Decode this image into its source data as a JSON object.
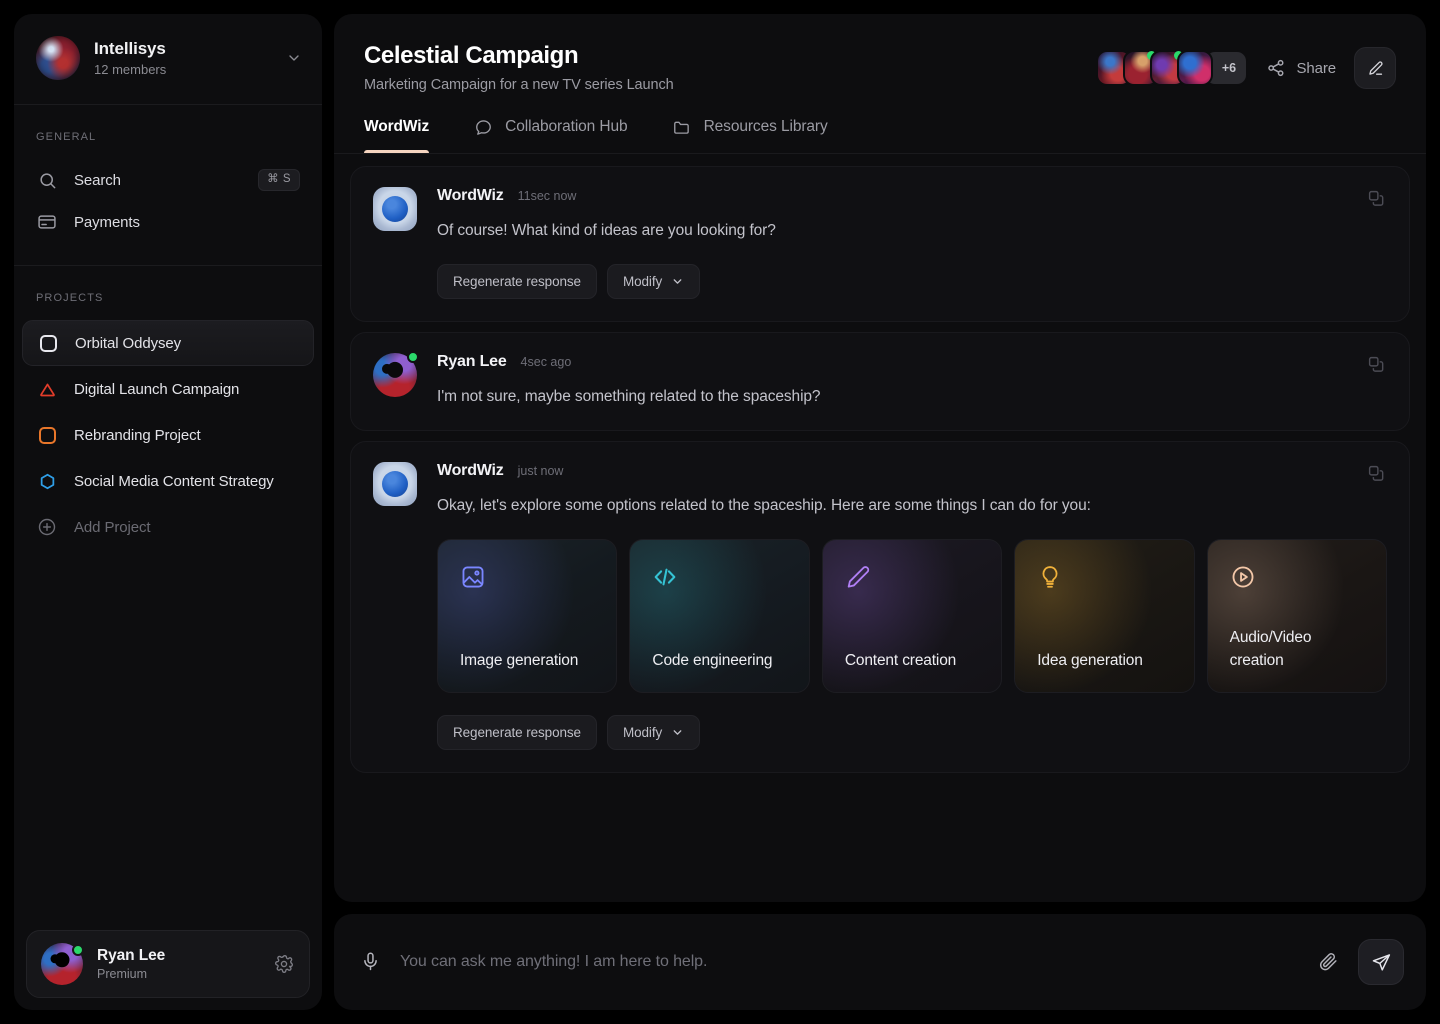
{
  "sidebar": {
    "workspace": {
      "name": "Intellisys",
      "members": "12 members",
      "chevron_icon": "chevron-down-icon"
    },
    "general_label": "GENERAL",
    "general_items": [
      {
        "label": "Search",
        "icon": "search-icon",
        "shortcut": "⌘ S"
      },
      {
        "label": "Payments",
        "icon": "credit-card-icon",
        "shortcut": ""
      }
    ],
    "projects_label": "PROJECTS",
    "projects": [
      {
        "label": "Orbital Oddysey",
        "icon": "square-icon",
        "color": "#e8e8ee",
        "active": true
      },
      {
        "label": "Digital Launch Campaign",
        "icon": "triangle-icon",
        "color": "#e23c2a",
        "active": false
      },
      {
        "label": "Rebranding Project",
        "icon": "square-icon",
        "color": "#e8762a",
        "active": false
      },
      {
        "label": "Social Media Content Strategy",
        "icon": "hexagon-icon",
        "color": "#2f9fe8",
        "active": false
      }
    ],
    "add_project": {
      "label": "Add Project",
      "icon": "plus-circle-icon"
    },
    "profile": {
      "name": "Ryan Lee",
      "plan": "Premium",
      "settings_icon": "gear-icon",
      "status_color": "#2bd96b"
    }
  },
  "header": {
    "title": "Celestial Campaign",
    "subtitle": "Marketing Campaign for a new TV series Launch",
    "avatar_overflow": "+6",
    "share_label": "Share",
    "share_icon": "share-nodes-icon",
    "edit_icon": "pencil-icon"
  },
  "tabs": [
    {
      "label": "WordWiz",
      "icon": "",
      "active": true
    },
    {
      "label": "Collaboration Hub",
      "icon": "chat-bubble-icon",
      "active": false
    },
    {
      "label": "Resources Library",
      "icon": "folder-icon",
      "active": false
    }
  ],
  "messages": [
    {
      "author": "WordWiz",
      "time": "11sec now",
      "text": "Of course! What kind of ideas are you looking for?",
      "avatar_type": "bot",
      "online": false,
      "copy_icon": "copy-icon",
      "actions": [
        {
          "label": "Regenerate response",
          "chevron": false
        },
        {
          "label": "Modify",
          "chevron": true
        }
      ],
      "cards": []
    },
    {
      "author": "Ryan Lee",
      "time": "4sec ago",
      "text": "I'm not sure, maybe something related to the spaceship?",
      "avatar_type": "user",
      "online": true,
      "copy_icon": "copy-icon",
      "actions": [],
      "cards": []
    },
    {
      "author": "WordWiz",
      "time": "just now",
      "text": "Okay, let's explore some options related to the spaceship. Here are some things I can do for you:",
      "avatar_type": "bot",
      "online": false,
      "copy_icon": "copy-icon",
      "actions": [
        {
          "label": "Regenerate response",
          "chevron": false
        },
        {
          "label": "Modify",
          "chevron": true
        }
      ],
      "cards": [
        {
          "label": "Image generation",
          "icon": "image-icon",
          "color": "#7a86ff"
        },
        {
          "label": "Code engineering",
          "icon": "code-icon",
          "color": "#35c3d4"
        },
        {
          "label": "Content creation",
          "icon": "pencil-icon",
          "color": "#b07ff5"
        },
        {
          "label": "Idea generation",
          "icon": "lightbulb-icon",
          "color": "#f0b13a"
        },
        {
          "label": "Audio/Video creation",
          "icon": "play-circle-icon",
          "color": "#f3c7a8"
        }
      ]
    }
  ],
  "composer": {
    "placeholder": "You can ask me anything! I am here to help.",
    "value": "",
    "mic_icon": "microphone-icon",
    "attach_icon": "paperclip-icon",
    "send_icon": "send-icon"
  },
  "theme": {
    "background": "#000000",
    "panel": "#0d0d0f",
    "accent": "#f6d5c0",
    "online": "#2bd96b"
  }
}
